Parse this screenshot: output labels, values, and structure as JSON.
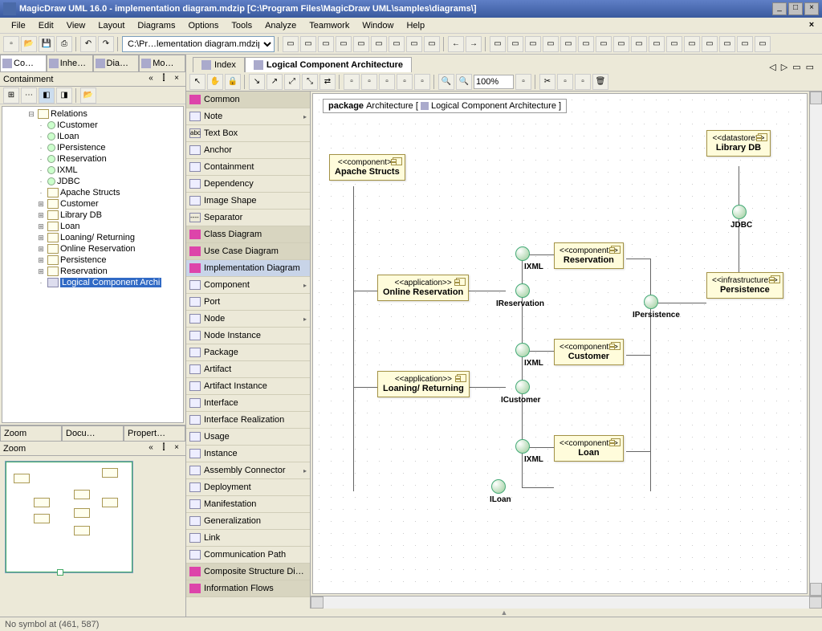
{
  "window": {
    "title": "MagicDraw UML 16.0 - implementation diagram.mdzip [C:\\Program Files\\MagicDraw UML\\samples\\diagrams\\]",
    "minimize": "_",
    "restore": "□",
    "close": "×"
  },
  "menu": {
    "file": "File",
    "edit": "Edit",
    "view": "View",
    "layout": "Layout",
    "diagrams": "Diagrams",
    "options": "Options",
    "tools": "Tools",
    "analyze": "Analyze",
    "teamwork": "Teamwork",
    "window": "Window",
    "help": "Help",
    "close_x": "×"
  },
  "toolbar": {
    "file_selector": "C:\\Pr…lementation diagram.mdzip"
  },
  "left_tabs": {
    "co": "Co…",
    "inhe": "Inhe…",
    "dia": "Dia…",
    "mo": "Mo…"
  },
  "containment": {
    "title": "Containment",
    "items": [
      {
        "label": "Relations",
        "icon": "box",
        "exp": "-",
        "indent": 0
      },
      {
        "label": "ICustomer",
        "icon": "circle",
        "exp": "",
        "indent": 1
      },
      {
        "label": "ILoan",
        "icon": "circle",
        "exp": "",
        "indent": 1
      },
      {
        "label": "IPersistence",
        "icon": "circle",
        "exp": "",
        "indent": 1
      },
      {
        "label": "IReservation",
        "icon": "circle",
        "exp": "",
        "indent": 1
      },
      {
        "label": "IXML",
        "icon": "circle",
        "exp": "",
        "indent": 1
      },
      {
        "label": "JDBC",
        "icon": "circle",
        "exp": "",
        "indent": 1
      },
      {
        "label": "Apache  Structs",
        "icon": "box",
        "exp": "",
        "indent": 1
      },
      {
        "label": "Customer",
        "icon": "box",
        "exp": "+",
        "indent": 1
      },
      {
        "label": "Library DB",
        "icon": "box",
        "exp": "+",
        "indent": 1
      },
      {
        "label": "Loan",
        "icon": "box",
        "exp": "+",
        "indent": 1
      },
      {
        "label": "Loaning/ Returning",
        "icon": "box",
        "exp": "+",
        "indent": 1
      },
      {
        "label": "Online Reservation",
        "icon": "box",
        "exp": "+",
        "indent": 1
      },
      {
        "label": "Persistence",
        "icon": "box",
        "exp": "+",
        "indent": 1
      },
      {
        "label": "Reservation",
        "icon": "box",
        "exp": "+",
        "indent": 1
      },
      {
        "label": "Logical Component Archi",
        "icon": "diag",
        "exp": "",
        "indent": 1,
        "selected": true
      }
    ]
  },
  "zoom": {
    "tab_zoom": "Zoom",
    "tab_docu": "Docu…",
    "tab_prop": "Propert…",
    "title": "Zoom"
  },
  "canvas_tabs": {
    "index": "Index",
    "logical": "Logical Component Architecture"
  },
  "zoom_value": "100%",
  "palette": {
    "items": [
      {
        "label": "Common",
        "type": "header"
      },
      {
        "label": "Note",
        "exp": "▸"
      },
      {
        "label": "Text Box",
        "prefix": "abc"
      },
      {
        "label": "Anchor"
      },
      {
        "label": "Containment"
      },
      {
        "label": "Dependency"
      },
      {
        "label": "Image Shape"
      },
      {
        "label": "Separator",
        "prefix": "----"
      },
      {
        "label": "Class Diagram",
        "type": "header"
      },
      {
        "label": "Use Case Diagram",
        "type": "header"
      },
      {
        "label": "Implementation Diagram",
        "type": "header",
        "selected": true
      },
      {
        "label": "Component",
        "exp": "▸"
      },
      {
        "label": "Port"
      },
      {
        "label": "Node",
        "exp": "▸"
      },
      {
        "label": "Node Instance"
      },
      {
        "label": "Package"
      },
      {
        "label": "Artifact"
      },
      {
        "label": "Artifact Instance"
      },
      {
        "label": "Interface"
      },
      {
        "label": "Interface Realization"
      },
      {
        "label": "Usage"
      },
      {
        "label": "Instance"
      },
      {
        "label": "Assembly Connector",
        "exp": "▸"
      },
      {
        "label": "Deployment"
      },
      {
        "label": "Manifestation"
      },
      {
        "label": "Generalization"
      },
      {
        "label": "Link"
      },
      {
        "label": "Communication Path"
      },
      {
        "label": "Composite Structure Di…",
        "type": "header"
      },
      {
        "label": "Information Flows",
        "type": "header"
      }
    ]
  },
  "diagram": {
    "package_label_prefix": "package",
    "package_name": "Architecture",
    "package_diagram": "Logical Component Architecture",
    "boxes": {
      "apache": {
        "stereo": "<<component>>",
        "name": "Apache Structs"
      },
      "librarydb": {
        "stereo": "<<datastore>>",
        "name": "Library DB"
      },
      "online": {
        "stereo": "<<application>>",
        "name": "Online Reservation"
      },
      "reservation": {
        "stereo": "<<component>>",
        "name": "Reservation"
      },
      "persistence": {
        "stereo": "<<infrastructure>>",
        "name": "Persistence"
      },
      "loaning": {
        "stereo": "<<application>>",
        "name": "Loaning/ Returning"
      },
      "customer": {
        "stereo": "<<component>>",
        "name": "Customer"
      },
      "loan": {
        "stereo": "<<component>>",
        "name": "Loan"
      }
    },
    "interfaces": {
      "jdbc": "JDBC",
      "ixml1": "IXML",
      "ireservation": "IReservation",
      "ipersistence": "IPersistence",
      "ixml2": "IXML",
      "icustomer": "ICustomer",
      "ixml3": "IXML",
      "iloan": "ILoan"
    }
  },
  "status": "No symbol at (461, 587)"
}
